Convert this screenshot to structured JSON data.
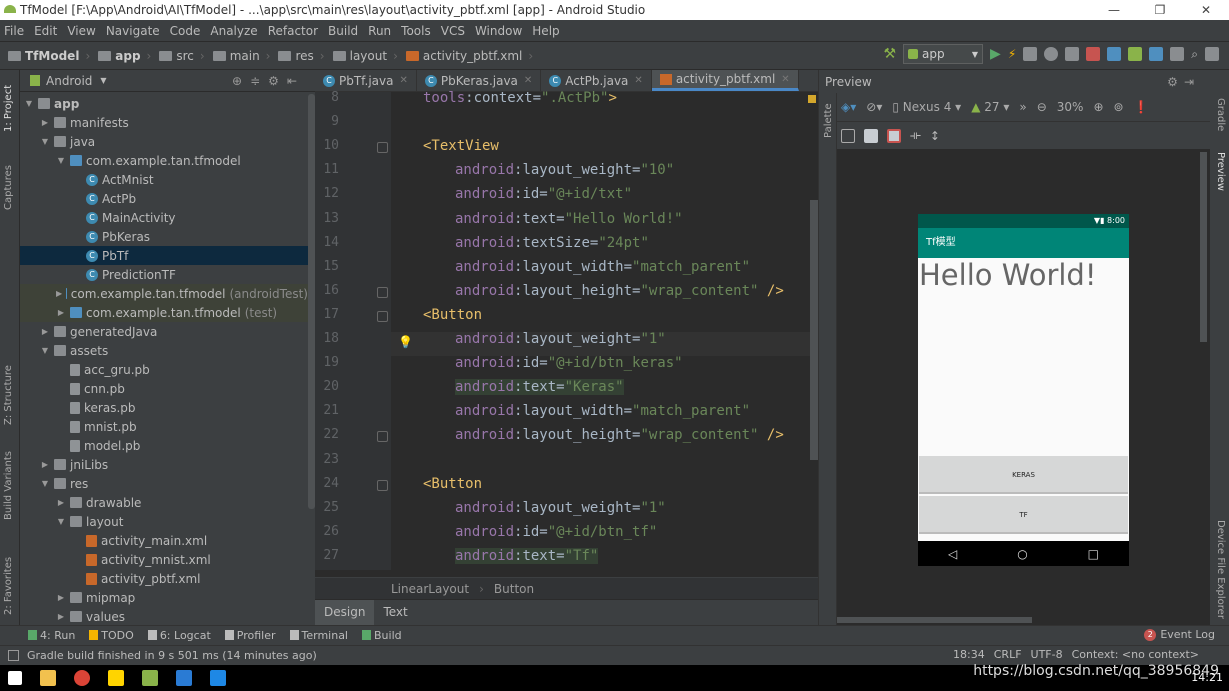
{
  "window": {
    "title": "TfModel [F:\\App\\Android\\AI\\TfModel] - ...\\app\\src\\main\\res\\layout\\activity_pbtf.xml [app] - Android Studio",
    "controls": [
      "—",
      "❐",
      "✕"
    ]
  },
  "menu": [
    "File",
    "Edit",
    "View",
    "Navigate",
    "Code",
    "Analyze",
    "Refactor",
    "Build",
    "Run",
    "Tools",
    "VCS",
    "Window",
    "Help"
  ],
  "breadcrumb": [
    "TfModel",
    "app",
    "src",
    "main",
    "res",
    "layout",
    "activity_pbtf.xml"
  ],
  "toolbar": {
    "run_config": "app"
  },
  "left_strip": [
    "1: Project",
    "Captures",
    "Z: Structure",
    "Build Variants",
    "2: Favorites"
  ],
  "project": {
    "view": "Android",
    "tree": [
      {
        "d": 0,
        "open": true,
        "t": "folder",
        "label": "app",
        "bold": true
      },
      {
        "d": 1,
        "open": false,
        "t": "folder",
        "label": "manifests"
      },
      {
        "d": 1,
        "open": true,
        "t": "folder",
        "label": "java"
      },
      {
        "d": 2,
        "open": true,
        "t": "src",
        "label": "com.example.tan.tfmodel"
      },
      {
        "d": 3,
        "t": "cls",
        "label": "ActMnist"
      },
      {
        "d": 3,
        "t": "cls",
        "label": "ActPb"
      },
      {
        "d": 3,
        "t": "cls",
        "label": "MainActivity"
      },
      {
        "d": 3,
        "t": "cls",
        "label": "PbKeras"
      },
      {
        "d": 3,
        "t": "cls",
        "label": "PbTf",
        "sel": true
      },
      {
        "d": 3,
        "t": "cls",
        "label": "PredictionTF"
      },
      {
        "d": 2,
        "open": false,
        "t": "src",
        "label": "com.example.tan.tfmodel",
        "note": "(androidTest)",
        "test": true
      },
      {
        "d": 2,
        "open": false,
        "t": "src",
        "label": "com.example.tan.tfmodel",
        "note": "(test)",
        "test": true
      },
      {
        "d": 1,
        "open": false,
        "t": "folder",
        "label": "generatedJava"
      },
      {
        "d": 1,
        "open": true,
        "t": "folder",
        "label": "assets"
      },
      {
        "d": 2,
        "t": "file",
        "label": "acc_gru.pb"
      },
      {
        "d": 2,
        "t": "file",
        "label": "cnn.pb"
      },
      {
        "d": 2,
        "t": "file",
        "label": "keras.pb"
      },
      {
        "d": 2,
        "t": "file",
        "label": "mnist.pb"
      },
      {
        "d": 2,
        "t": "file",
        "label": "model.pb"
      },
      {
        "d": 1,
        "open": false,
        "t": "folder",
        "label": "jniLibs"
      },
      {
        "d": 1,
        "open": true,
        "t": "folder",
        "label": "res"
      },
      {
        "d": 2,
        "open": false,
        "t": "folder",
        "label": "drawable"
      },
      {
        "d": 2,
        "open": true,
        "t": "folder",
        "label": "layout"
      },
      {
        "d": 3,
        "t": "xml",
        "label": "activity_main.xml"
      },
      {
        "d": 3,
        "t": "xml",
        "label": "activity_mnist.xml"
      },
      {
        "d": 3,
        "t": "xml",
        "label": "activity_pbtf.xml"
      },
      {
        "d": 2,
        "open": false,
        "t": "folder",
        "label": "mipmap"
      },
      {
        "d": 2,
        "open": false,
        "t": "folder",
        "label": "values"
      }
    ]
  },
  "tabs": [
    {
      "label": "PbTf.java",
      "k": "c"
    },
    {
      "label": "PbKeras.java",
      "k": "c"
    },
    {
      "label": "ActPb.java",
      "k": "c"
    },
    {
      "label": "activity_pbtf.xml",
      "k": "x",
      "active": true
    }
  ],
  "code": [
    {
      "n": 8,
      "i": 1,
      "s": [
        [
          "ns",
          "tools"
        ],
        [
          "plain",
          ":context="
        ],
        [
          "val",
          "\".ActPb\""
        ],
        [
          "tag",
          ">"
        ]
      ]
    },
    {
      "n": 9,
      "i": 0,
      "s": []
    },
    {
      "n": 10,
      "i": 1,
      "f": true,
      "s": [
        [
          "tag",
          "<TextView"
        ]
      ]
    },
    {
      "n": 11,
      "i": 2,
      "s": [
        [
          "attr",
          "android"
        ],
        [
          "plain",
          ":layout_weight="
        ],
        [
          "val",
          "\"10\""
        ]
      ]
    },
    {
      "n": 12,
      "i": 2,
      "s": [
        [
          "attr",
          "android"
        ],
        [
          "plain",
          ":id="
        ],
        [
          "val",
          "\"@+id/txt\""
        ]
      ]
    },
    {
      "n": 13,
      "i": 2,
      "s": [
        [
          "attr",
          "android"
        ],
        [
          "plain",
          ":text="
        ],
        [
          "val",
          "\"Hello World!\""
        ]
      ]
    },
    {
      "n": 14,
      "i": 2,
      "s": [
        [
          "attr",
          "android"
        ],
        [
          "plain",
          ":textSize="
        ],
        [
          "val",
          "\"24pt\""
        ]
      ]
    },
    {
      "n": 15,
      "i": 2,
      "s": [
        [
          "attr",
          "android"
        ],
        [
          "plain",
          ":layout_width="
        ],
        [
          "val",
          "\"match_parent\""
        ]
      ]
    },
    {
      "n": 16,
      "i": 2,
      "f": true,
      "s": [
        [
          "attr",
          "android"
        ],
        [
          "plain",
          ":layout_height="
        ],
        [
          "val",
          "\"wrap_content\""
        ],
        [
          "tag",
          " />"
        ]
      ]
    },
    {
      "n": 17,
      "i": 1,
      "f": true,
      "s": [
        [
          "tag",
          "<Button"
        ]
      ]
    },
    {
      "n": 18,
      "i": 2,
      "s": [
        [
          "attr",
          "android"
        ],
        [
          "plain",
          ":layout_weight="
        ],
        [
          "val",
          "\"1\""
        ]
      ]
    },
    {
      "n": 19,
      "i": 2,
      "s": [
        [
          "attr",
          "android"
        ],
        [
          "plain",
          ":id="
        ],
        [
          "val",
          "\"@+id/btn_keras\""
        ]
      ]
    },
    {
      "n": 20,
      "i": 2,
      "h": true,
      "s": [
        [
          "attr",
          "android"
        ],
        [
          "plain",
          ":text="
        ],
        [
          "val",
          "\"Keras\""
        ]
      ]
    },
    {
      "n": 21,
      "i": 2,
      "s": [
        [
          "attr",
          "android"
        ],
        [
          "plain",
          ":layout_width="
        ],
        [
          "val",
          "\"match_parent\""
        ]
      ]
    },
    {
      "n": 22,
      "i": 2,
      "f": true,
      "s": [
        [
          "attr",
          "android"
        ],
        [
          "plain",
          ":layout_height="
        ],
        [
          "val",
          "\"wrap_content\""
        ],
        [
          "tag",
          " />"
        ]
      ]
    },
    {
      "n": 23,
      "i": 0,
      "s": []
    },
    {
      "n": 24,
      "i": 1,
      "f": true,
      "s": [
        [
          "tag",
          "<Button"
        ]
      ]
    },
    {
      "n": 25,
      "i": 2,
      "s": [
        [
          "attr",
          "android"
        ],
        [
          "plain",
          ":layout_weight="
        ],
        [
          "val",
          "\"1\""
        ]
      ]
    },
    {
      "n": 26,
      "i": 2,
      "s": [
        [
          "attr",
          "android"
        ],
        [
          "plain",
          ":id="
        ],
        [
          "val",
          "\"@+id/btn_tf\""
        ]
      ]
    },
    {
      "n": 27,
      "i": 2,
      "h": true,
      "s": [
        [
          "attr",
          "android"
        ],
        [
          "plain",
          ":text="
        ],
        [
          "val",
          "\"Tf\""
        ]
      ]
    }
  ],
  "editor_breadcrumb": [
    "LinearLayout",
    "Button"
  ],
  "editor_mode_tabs": [
    "Design",
    "Text"
  ],
  "preview": {
    "title": "Preview",
    "device": "Nexus 4",
    "api": "27",
    "zoom": "30%",
    "palette": "Palette",
    "phone": {
      "time": "8:00",
      "app_title": "Tf模型",
      "text": "Hello World!",
      "buttons": [
        "KERAS",
        "TF"
      ],
      "nav": [
        "◁",
        "○",
        "□"
      ]
    }
  },
  "right_strip": [
    "Gradle",
    "Preview",
    "Device File Explorer"
  ],
  "bottom_tools": [
    "4: Run",
    "TODO",
    "6: Logcat",
    "Profiler",
    "Terminal",
    "Build"
  ],
  "event_log": {
    "count": "2",
    "label": "Event Log"
  },
  "status": {
    "message": "Gradle build finished in 9 s 501 ms (14 minutes ago)",
    "position": "18:34",
    "line_sep": "CRLF",
    "encoding": "UTF-8",
    "context": "Context: <no context>"
  },
  "taskbar": {
    "watermark": "https://blog.csdn.net/qq_38956849",
    "clock": "14:21"
  }
}
